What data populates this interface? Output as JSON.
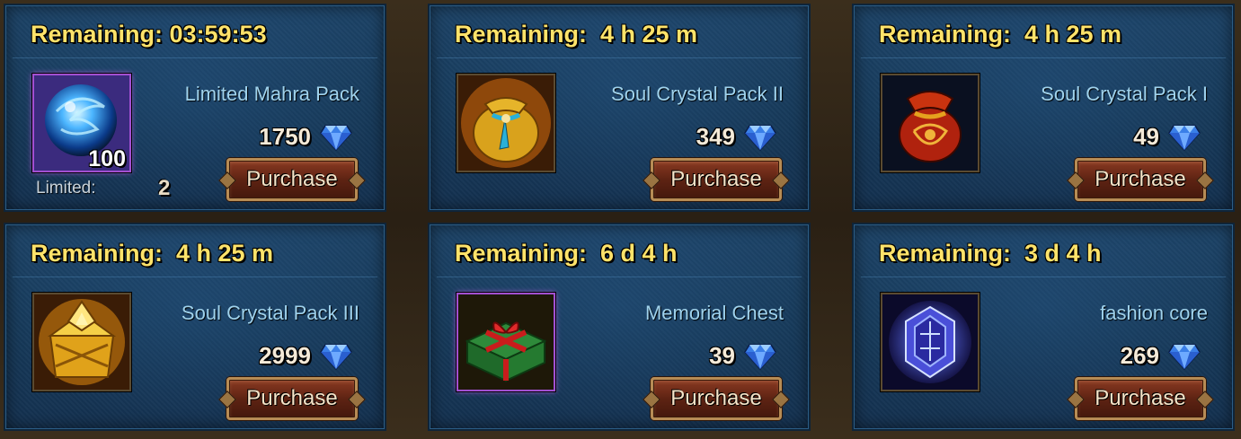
{
  "shop": {
    "cards": [
      {
        "remaining": "Remaining: 03:59:53",
        "name": "Limited Mahra Pack",
        "price": "1750",
        "qty": "100",
        "limited_label": "Limited:",
        "limited_value": "2",
        "purchase": "Purchase",
        "icon": "blue-orb-icon"
      },
      {
        "remaining": "Remaining:  4 h 25 m",
        "name": "Soul Crystal Pack II",
        "price": "349",
        "purchase": "Purchase",
        "icon": "gold-pouch-icon"
      },
      {
        "remaining": "Remaining:  4 h 25 m",
        "name": "Soul Crystal Pack I",
        "price": "49",
        "purchase": "Purchase",
        "icon": "red-pouch-icon"
      },
      {
        "remaining": "Remaining:  4 h 25 m",
        "name": "Soul Crystal Pack III",
        "price": "2999",
        "purchase": "Purchase",
        "icon": "gold-chest-icon"
      },
      {
        "remaining": "Remaining:  6 d 4 h",
        "name": "Memorial Chest",
        "price": "39",
        "purchase": "Purchase",
        "icon": "gift-box-icon"
      },
      {
        "remaining": "Remaining:  3 d 4 h",
        "name": "fashion core",
        "price": "269",
        "purchase": "Purchase",
        "icon": "fashion-core-icon"
      }
    ]
  },
  "colors": {
    "remaining_text": "#ffe36a",
    "item_name": "#9fd2ec",
    "purchase_bg": "#5e2313",
    "diamond": "#4a8df0"
  }
}
